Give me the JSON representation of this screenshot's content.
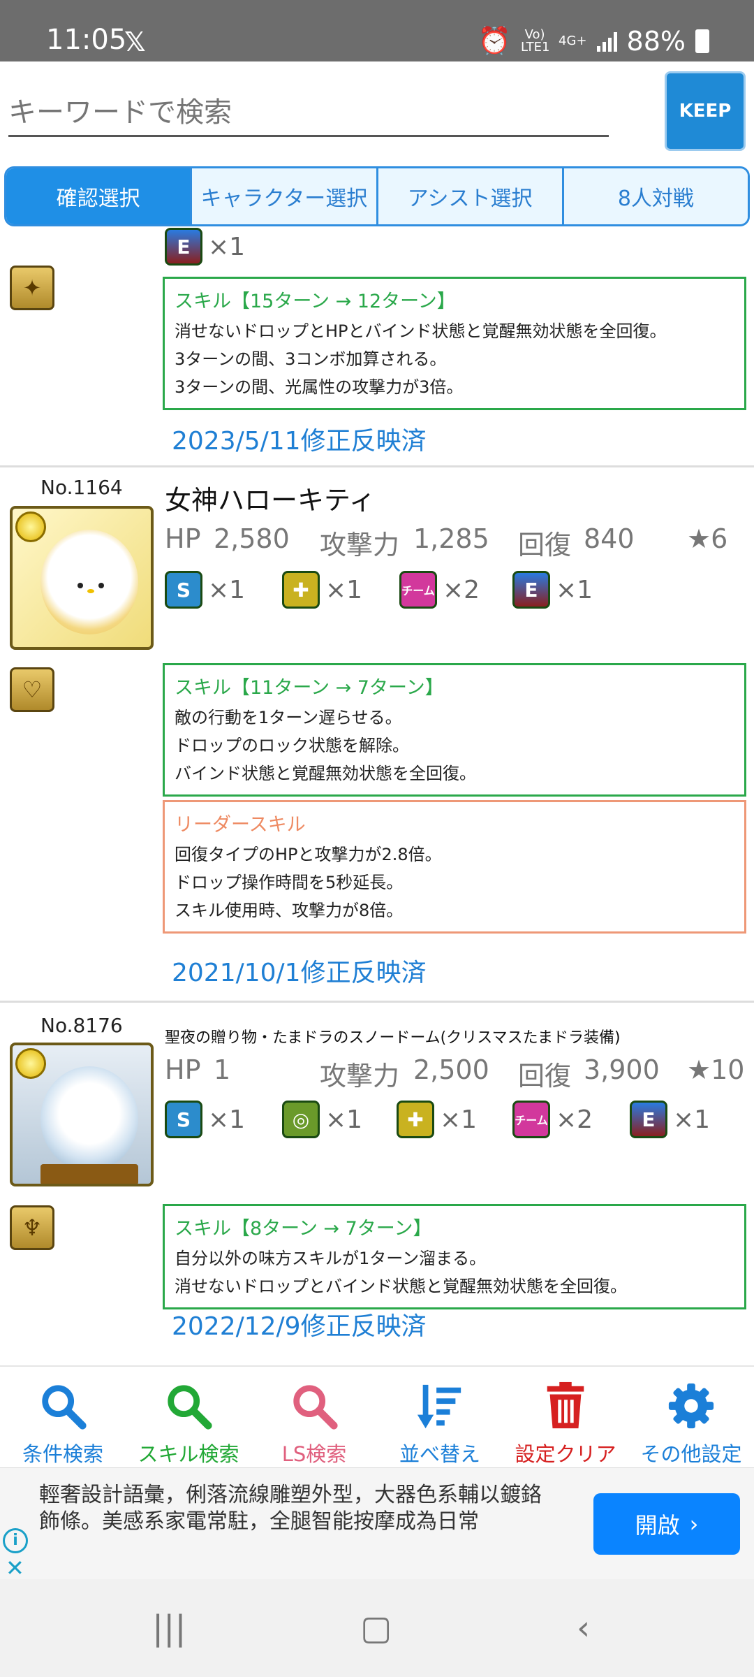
{
  "status": {
    "time": "11:05",
    "x_logo": "𝕏",
    "network": "4G+",
    "lte": "Vo) LTE1",
    "battery": "88%"
  },
  "search": {
    "placeholder": "キーワードで検索",
    "keep_label": "KEEP"
  },
  "tabs": [
    {
      "label": "確認選択",
      "active": true
    },
    {
      "label": "キャラクター選択",
      "active": false
    },
    {
      "label": "アシスト選択",
      "active": false
    },
    {
      "label": "8人対戦",
      "active": false
    }
  ],
  "card0": {
    "awakening_count": "×1",
    "skill_header": "スキル【15ターン → 12ターン】",
    "skill_lines": [
      "消せないドロップとHPとバインド状態と覚醒無効状態を全回復。",
      "3ターンの間、3コンボ加算される。",
      "3ターンの間、光属性の攻撃力が3倍。"
    ],
    "date": "2023/5/11修正反映済"
  },
  "card1": {
    "no": "No.1164",
    "name": "女神ハローキティ",
    "hp_label": "HP",
    "hp": "2,580",
    "atk_label": "攻撃力",
    "atk": "1,285",
    "rcv_label": "回復",
    "rcv": "840",
    "rarity": "★6",
    "awakenings": [
      "×1",
      "×1",
      "×2",
      "×1"
    ],
    "skill_header": "スキル【11ターン → 7ターン】",
    "skill_lines": [
      "敵の行動を1ターン遅らせる。",
      "ドロップのロック状態を解除。",
      "バインド状態と覚醒無効状態を全回復。"
    ],
    "leader_header": "リーダースキル",
    "leader_lines": [
      "回復タイプのHPと攻撃力が2.8倍。",
      "ドロップ操作時間を5秒延長。",
      "スキル使用時、攻撃力が8倍。"
    ],
    "date": "2021/10/1修正反映済"
  },
  "card2": {
    "no": "No.8176",
    "name": "聖夜の贈り物・たまドラのスノードーム(クリスマスたまドラ装備)",
    "hp_label": "HP",
    "hp": "1",
    "atk_label": "攻撃力",
    "atk": "2,500",
    "rcv_label": "回復",
    "rcv": "3,900",
    "rarity": "★10",
    "awakenings": [
      "×1",
      "×1",
      "×1",
      "×2",
      "×1"
    ],
    "skill_header": "スキル【8ターン → 7ターン】",
    "skill_lines": [
      "自分以外の味方スキルが1ターン溜まる。",
      "消せないドロップとバインド状態と覚醒無効状態を全回復。"
    ],
    "date": "2022/12/9修正反映済"
  },
  "bottom_nav": [
    {
      "label": "条件検索",
      "color": "#1b7fd8",
      "icon": "search-icon"
    },
    {
      "label": "スキル検索",
      "color": "#22a836",
      "icon": "search-icon"
    },
    {
      "label": "LS検索",
      "color": "#e0607e",
      "icon": "search-icon"
    },
    {
      "label": "並べ替え",
      "color": "#1b7fd8",
      "icon": "sort-icon"
    },
    {
      "label": "設定クリア",
      "color": "#d62020",
      "icon": "trash-icon"
    },
    {
      "label": "その他設定",
      "color": "#1b7fd8",
      "icon": "gear-icon"
    }
  ],
  "ad": {
    "text": "輕奢設計語彙，俐落流線雕塑外型，大器色系輔以鍍鉻飾條。美感系家電常駐，全腿智能按摩成為日常",
    "button": "開啟"
  }
}
